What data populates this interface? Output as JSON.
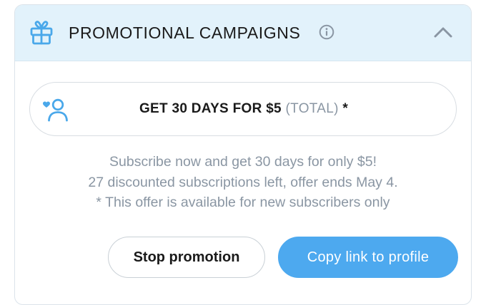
{
  "header": {
    "title": "PROMOTIONAL CAMPAIGNS",
    "icon": "gift-icon",
    "info_icon": "info-icon",
    "collapse_icon": "chevron-up-icon"
  },
  "offer": {
    "icon": "fan-heart-icon",
    "main": "GET 30 DAYS FOR $5",
    "qualifier": "(TOTAL)",
    "asterisk": "*"
  },
  "description": {
    "line1": "Subscribe now and get 30 days for only $5!",
    "line2": "27 discounted subscriptions left, offer ends May 4.",
    "line3": "* This offer is available for new subscribers only"
  },
  "buttons": {
    "stop_label": "Stop promotion",
    "copy_label": "Copy link to profile"
  },
  "colors": {
    "accent": "#4da9ef",
    "header_bg": "#e2f2fb",
    "muted_text": "#8a96a3",
    "icon_blue": "#4aa8ea"
  }
}
